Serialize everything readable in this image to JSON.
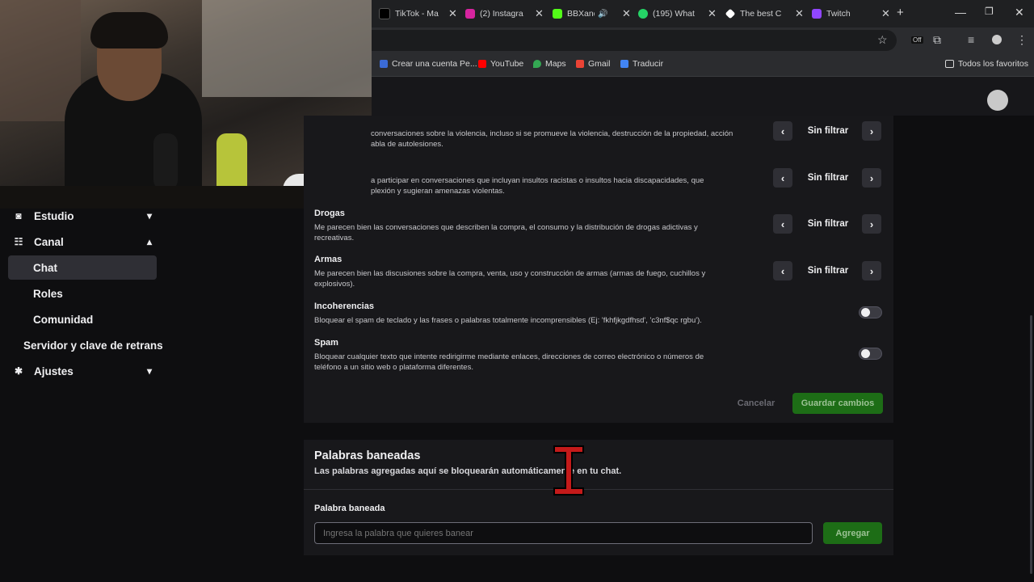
{
  "browser": {
    "tabs": [
      {
        "title": "TikTok - Ma",
        "icon": "tiktok-icon",
        "color": "#ffffff"
      },
      {
        "title": "(2) Instagra",
        "icon": "instagram-icon",
        "color": "#d6249f"
      },
      {
        "title": "BBXand",
        "icon": "kick-icon",
        "color": "#53fc18"
      },
      {
        "title": "(195) What",
        "icon": "whatsapp-icon",
        "color": "#25d366"
      },
      {
        "title": "The best C",
        "icon": "diamond-icon",
        "color": "#ffffff"
      },
      {
        "title": "Twitch",
        "icon": "twitch-icon",
        "color": "#9146ff"
      }
    ],
    "new_tab": "+",
    "bookmarks": [
      {
        "label": "Crear una cuenta Pe...",
        "color": "#3b6bd6"
      },
      {
        "label": "YouTube",
        "color": "#ff0000"
      },
      {
        "label": "Maps",
        "color": "#34a853"
      },
      {
        "label": "Gmail",
        "color": "#ea4335"
      },
      {
        "label": "Traducir",
        "color": "#4285f4"
      }
    ],
    "all_favorites": "Todos los favoritos",
    "ext_badge": "Off"
  },
  "sidebar": {
    "estudio": "Estudio",
    "canal": "Canal",
    "chat": "Chat",
    "roles": "Roles",
    "comunidad": "Comunidad",
    "servidor": "Servidor y clave de retrans",
    "ajustes": "Ajustes"
  },
  "moderation": {
    "rows": [
      {
        "title": "",
        "desc": "conversaciones sobre la violencia, incluso si se promueve la violencia, destrucción de la propiedad, acción\nabla de autolesiones.",
        "value": "Sin filtrar"
      },
      {
        "title": "",
        "desc": "a participar en conversaciones que incluyan insultos racistas o insultos hacia discapacidades, que\nplexión y sugieran amenazas violentas.",
        "value": "Sin filtrar"
      },
      {
        "title": "Drogas",
        "desc": "Me parecen bien las conversaciones que describen la compra, el consumo y la distribución de drogas adictivas y\nrecreativas.",
        "value": "Sin filtrar"
      },
      {
        "title": "Armas",
        "desc": "Me parecen bien las discusiones sobre la compra, venta, uso y construcción de armas (armas de fuego, cuchillos y\nexplosivos).",
        "value": "Sin filtrar"
      }
    ],
    "incoherencias": {
      "title": "Incoherencias",
      "desc": "Bloquear el spam de teclado y las frases o palabras totalmente incomprensibles (Ej: 'fkhfjkgdfhsd', 'c3nf$qc rgbu').",
      "enabled": false
    },
    "spam": {
      "title": "Spam",
      "desc": "Bloquear cualquier texto que intente redirigirme mediante enlaces, direcciones de correo electrónico o números de\nteléfono a un sitio web o plataforma diferentes.",
      "enabled": false
    },
    "cancel": "Cancelar",
    "save": "Guardar cambios",
    "accent": "#1d6d16"
  },
  "banned": {
    "title": "Palabras baneadas",
    "subtitle": "Las palabras agregadas aquí se bloquearán automáticamente en tu chat.",
    "field_label": "Palabra baneada",
    "placeholder": "Ingresa la palabra que quieres banear",
    "add": "Agregar"
  }
}
